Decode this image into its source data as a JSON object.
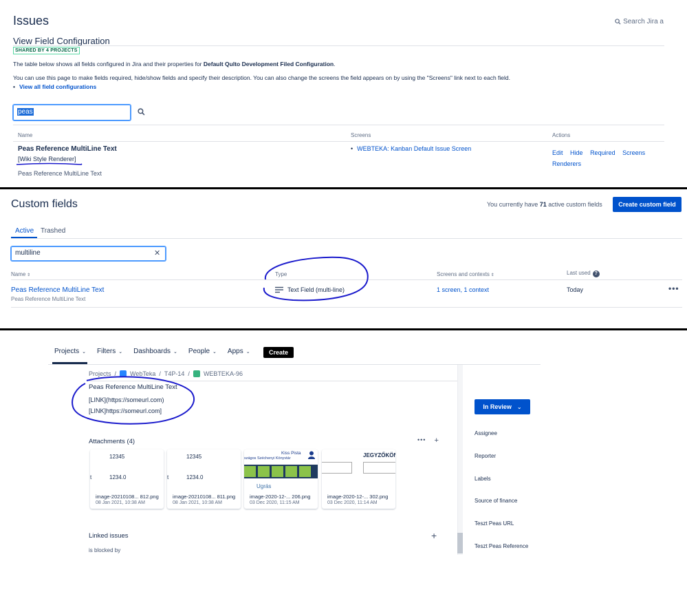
{
  "section1": {
    "title": "Issues",
    "search_label": "Search Jira a",
    "subtitle": "View Field Configuration",
    "badge": "SHARED BY 4 PROJECTS",
    "desc1_pre": "The table below shows all fields configured in Jira and their properties for ",
    "desc1_bold": "Default Qulto Development Filed Configuration",
    "desc1_post": ".",
    "desc2": "You can use this page to make fields required, hide/show fields and specify their description. You can also change the screens the field appears on by using the \"Screens\" link next to each field.",
    "view_all_link": "View all field configurations",
    "search_value": "peas",
    "columns": {
      "name": "Name",
      "screens": "Screens",
      "actions": "Actions"
    },
    "row": {
      "name": "Peas Reference MultiLine Text",
      "renderer": "[Wiki Style Renderer]",
      "description": "Peas Reference MultiLine Text",
      "screen": "WEBTEKA: Kanban Default Issue Screen",
      "actions": [
        "Edit",
        "Hide",
        "Required",
        "Screens"
      ],
      "actions2": [
        "Renderers"
      ]
    }
  },
  "section2": {
    "title": "Custom fields",
    "count_pre": "You currently have ",
    "count_num": "71",
    "count_post": " active custom fields",
    "create_button": "Create custom field",
    "tabs": [
      "Active",
      "Trashed"
    ],
    "search_value": "multiline",
    "columns": {
      "name": "Name",
      "type": "Type",
      "screens": "Screens and contexts",
      "last_used": "Last used"
    },
    "row": {
      "name": "Peas Reference MultiLine Text",
      "description": "Peas Reference MultiLine Text",
      "type": "Text Field (multi-line)",
      "screens": "1 screen, 1 context",
      "last_used": "Today"
    }
  },
  "section3": {
    "nav": [
      "Projects",
      "Filters",
      "Dashboards",
      "People",
      "Apps"
    ],
    "create_button": "Create",
    "breadcrumbs": [
      "Projects",
      "WebTeka",
      "T4P-14",
      "WEBTEKA-96"
    ],
    "field_title": "Peas Reference MultiLine Text",
    "field_lines": [
      "[LINK](https://someurl.com)",
      "[LINK]https://someurl.com]"
    ],
    "attachments_title": "Attachments (4)",
    "attachments": [
      {
        "name": "image-20210108... 812.png",
        "date": "08 Jan 2021, 10:38 AM",
        "t1": "12345",
        "t2": "1234.0"
      },
      {
        "name": "image-20210108... 811.png",
        "date": "08 Jan 2021, 10:38 AM",
        "t1": "12345",
        "t2": "1234.0"
      },
      {
        "name": "image-2020-12-... 206.png",
        "date": "03 Dec 2020, 11:15 AM",
        "t1": "Kiss Pista",
        "t2": "szágos Széchenyi Könyvtár",
        "t3": "Ugrás"
      },
      {
        "name": "image-2020-12-... 302.png",
        "date": "03 Dec 2020, 11:14 AM",
        "t1": "JEGYZŐKÖNY"
      }
    ],
    "linked_title": "Linked issues",
    "blocked_by": "is blocked by",
    "status_button": "In Review",
    "sidebar_labels": [
      "Assignee",
      "Reporter",
      "Labels",
      "Source of finance",
      "Teszt Peas URL",
      "Teszt Peas Reference"
    ]
  },
  "colors": {
    "brand": "#0052cc",
    "annotation": "#1a1acc",
    "green": "#8bc34a"
  }
}
